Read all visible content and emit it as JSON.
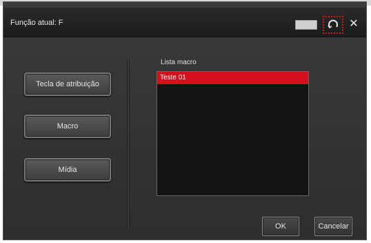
{
  "window": {
    "title": "Função atual: F"
  },
  "sidebar": {
    "buttons": [
      {
        "label": "Tecla de atribuição"
      },
      {
        "label": "Macro"
      },
      {
        "label": "Mídia"
      }
    ]
  },
  "macro_list": {
    "label": "Lista macro",
    "items": [
      "Teste 01"
    ],
    "selected_index": 0
  },
  "footer": {
    "ok_label": "OK",
    "cancel_label": "Cancelar"
  },
  "icons": {
    "refresh": "refresh-icon",
    "close": "close-icon"
  },
  "colors": {
    "selection": "#d4101d",
    "highlight_box": "#e01818"
  }
}
